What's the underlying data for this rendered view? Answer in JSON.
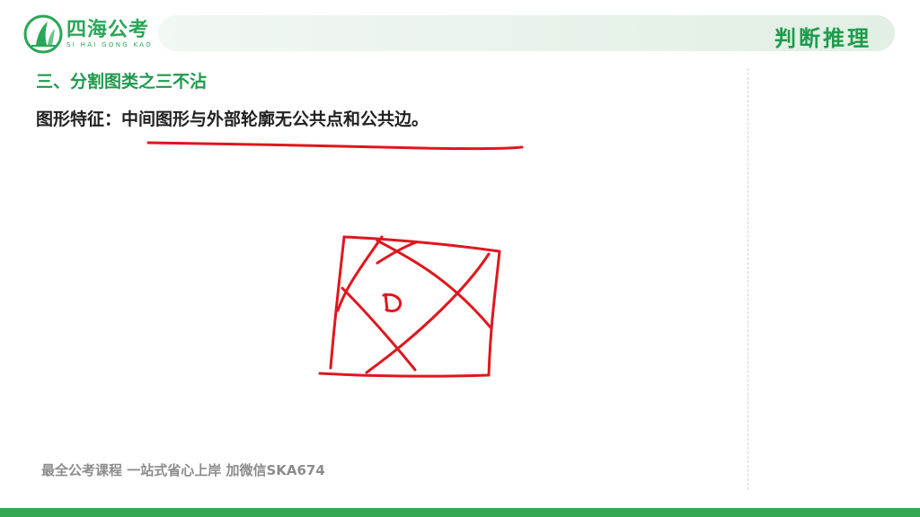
{
  "logo": {
    "title": "四海公考",
    "subtitle": "SI HAI GONG KAO",
    "icon": "sail-leaf-logo"
  },
  "header": {
    "label": "判断推理"
  },
  "content": {
    "section_title": "三、分割图类之三不沾",
    "feature_text": "图形特征：中间图形与外部轮廓无公共点和公共边。",
    "drawing_letter": "D"
  },
  "footer": {
    "note": "最全公考课程 一站式省心上岸 加微信SKA674"
  },
  "colors": {
    "brand_green": "#2aa657",
    "header_bar": "#e1efe4",
    "annotation_red": "#e0161e",
    "bottom_bar": "#34a853"
  }
}
